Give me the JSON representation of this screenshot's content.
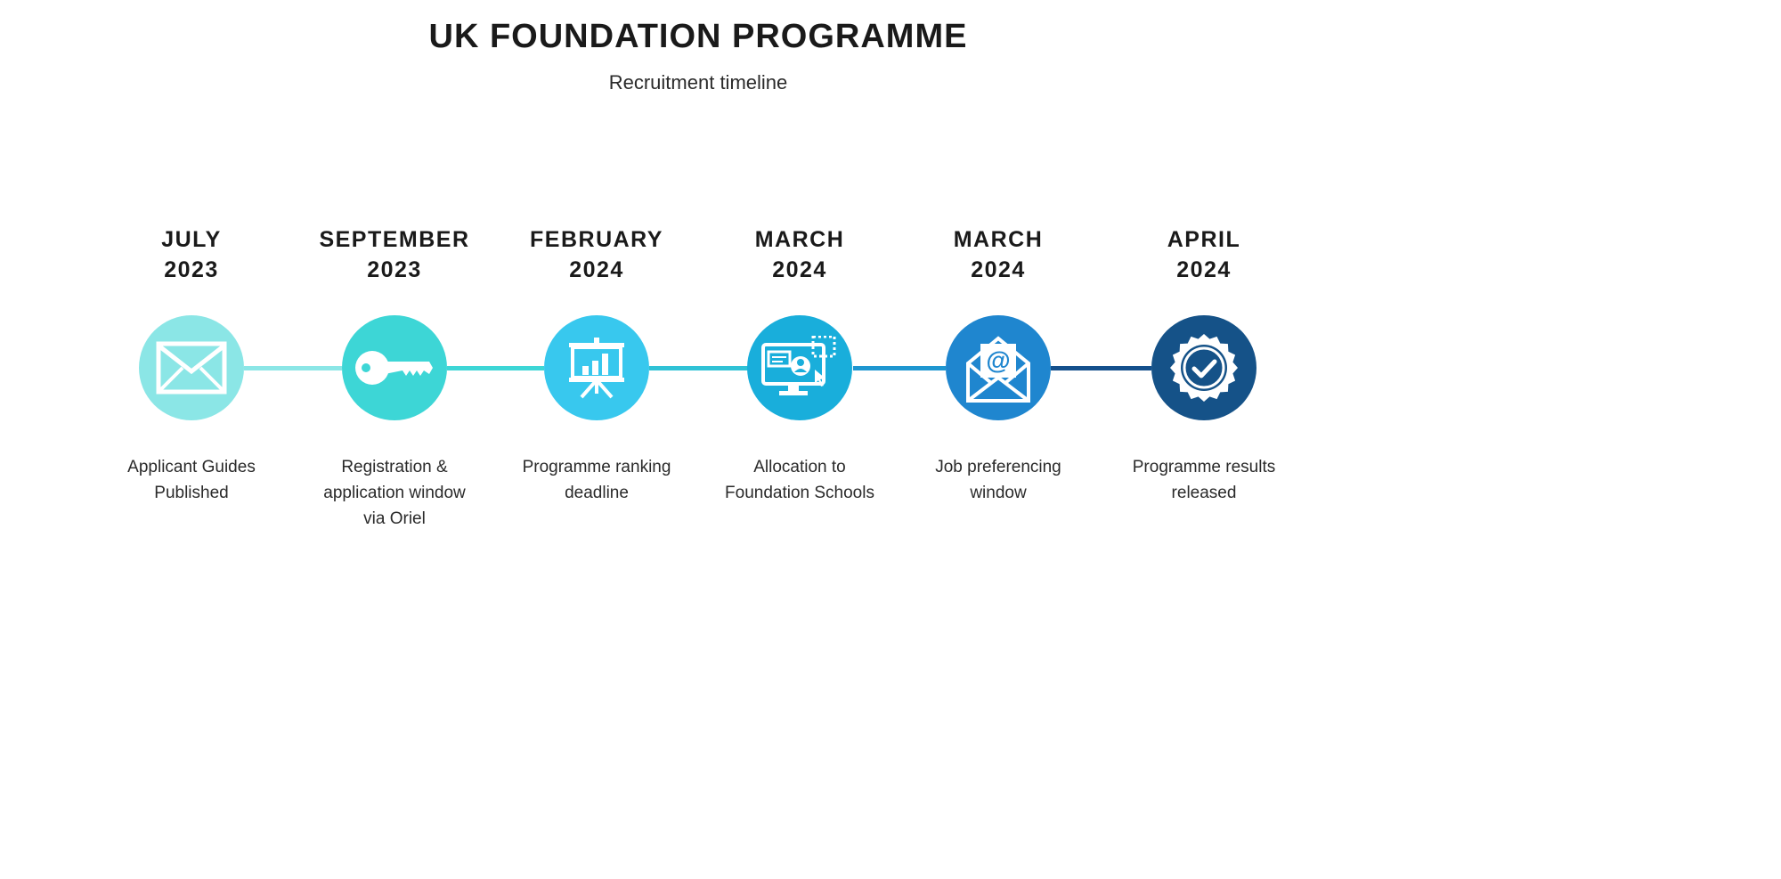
{
  "header": {
    "title": "UK FOUNDATION PROGRAMME",
    "subtitle": "Recruitment timeline"
  },
  "steps": [
    {
      "month": "JULY",
      "year": "2023",
      "label": "Applicant Guides Published",
      "icon": "envelope-icon",
      "color": "#8be6e6"
    },
    {
      "month": "SEPTEMBER",
      "year": "2023",
      "label": "Registration & application window via Oriel",
      "icon": "key-icon",
      "color": "#3dd6d6"
    },
    {
      "month": "FEBRUARY",
      "year": "2024",
      "label": "Programme ranking deadline",
      "icon": "presentation-chart-icon",
      "color": "#38c8ee"
    },
    {
      "month": "MARCH",
      "year": "2024",
      "label": "Allocation to Foundation Schools",
      "icon": "computer-profile-icon",
      "color": "#19aedb"
    },
    {
      "month": "MARCH",
      "year": "2024",
      "label": "Job preferencing window",
      "icon": "email-at-icon",
      "color": "#1f86cf"
    },
    {
      "month": "APRIL",
      "year": "2024",
      "label": "Programme results released",
      "icon": "badge-check-icon",
      "color": "#155288"
    }
  ],
  "connector_colors": [
    "#8be6e6",
    "#3dd6d6",
    "#2fc2d6",
    "#1e96d0",
    "#14508c"
  ]
}
